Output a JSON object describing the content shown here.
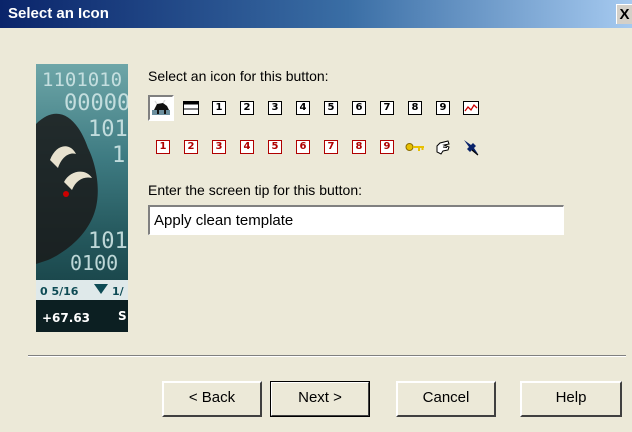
{
  "window": {
    "title": "Select an Icon",
    "close_label": "X"
  },
  "side_image": {
    "digits_rows": [
      "1101010",
      "00000",
      "101",
      "1",
      "101",
      "0100"
    ],
    "ticker_fraction": "0 5/16",
    "ticker_other": "1/",
    "ticker_change": "+67.63",
    "ticker_letter": "S"
  },
  "icons": {
    "prompt": "Select an icon for this button:",
    "row1": [
      {
        "name": "bull-icon",
        "glyph": ""
      },
      {
        "name": "window-icon",
        "glyph": ""
      },
      {
        "name": "number-1-icon",
        "glyph": "1"
      },
      {
        "name": "number-2-icon",
        "glyph": "2"
      },
      {
        "name": "number-3-icon",
        "glyph": "3"
      },
      {
        "name": "number-4-icon",
        "glyph": "4"
      },
      {
        "name": "number-5-icon",
        "glyph": "5"
      },
      {
        "name": "number-6-icon",
        "glyph": "6"
      },
      {
        "name": "number-7-icon",
        "glyph": "7"
      },
      {
        "name": "number-8-icon",
        "glyph": "8"
      },
      {
        "name": "number-9-icon",
        "glyph": "9"
      },
      {
        "name": "chart-icon",
        "glyph": ""
      }
    ],
    "row2": [
      {
        "name": "red-number-1-icon",
        "glyph": "1"
      },
      {
        "name": "red-number-2-icon",
        "glyph": "2"
      },
      {
        "name": "red-number-3-icon",
        "glyph": "3"
      },
      {
        "name": "red-number-4-icon",
        "glyph": "4"
      },
      {
        "name": "red-number-5-icon",
        "glyph": "5"
      },
      {
        "name": "red-number-6-icon",
        "glyph": "6"
      },
      {
        "name": "red-number-7-icon",
        "glyph": "7"
      },
      {
        "name": "red-number-8-icon",
        "glyph": "8"
      },
      {
        "name": "red-number-9-icon",
        "glyph": "9"
      },
      {
        "name": "key-icon",
        "glyph": ""
      },
      {
        "name": "hand-pointer-icon",
        "glyph": ""
      },
      {
        "name": "pushpin-icon",
        "glyph": ""
      }
    ]
  },
  "screen_tip": {
    "prompt": "Enter the screen tip for this button:",
    "value": "Apply clean template"
  },
  "buttons": {
    "back": "< Back",
    "next": "Next >",
    "cancel": "Cancel",
    "help": "Help"
  },
  "colors": {
    "title_bar": "#0a246a",
    "dialog_bg": "#ece9d8",
    "red_icon": "#b00000",
    "key_icon": "#e8c000",
    "pin_icon": "#0a246a"
  }
}
